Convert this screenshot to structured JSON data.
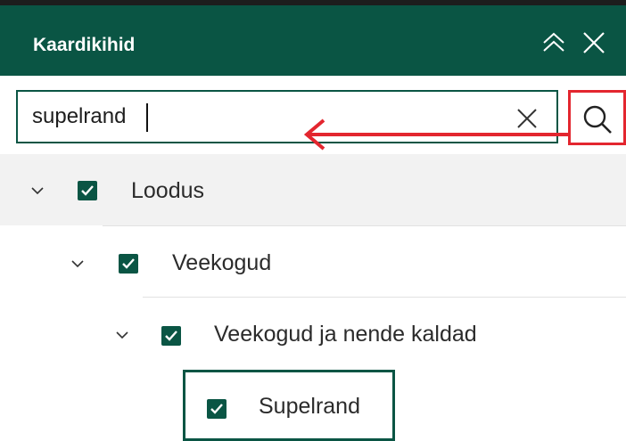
{
  "panel": {
    "title": "Kaardikihid",
    "icons": {
      "collapse": "double-chevron-up-icon",
      "close": "close-icon"
    }
  },
  "search": {
    "value": "supelrand",
    "clear_icon": "close-icon",
    "button_icon": "search-icon"
  },
  "tree": {
    "items": [
      {
        "label": "Loodus",
        "checked": true,
        "expanded": true
      },
      {
        "label": "Veekogud",
        "checked": true,
        "expanded": true
      },
      {
        "label": "Veekogud ja nende kaldad",
        "checked": true,
        "expanded": true
      },
      {
        "label": "Supelrand",
        "checked": true
      }
    ]
  },
  "colors": {
    "header": "#0a5544",
    "checkbox": "#0a5544",
    "highlight": "#e3262f"
  }
}
